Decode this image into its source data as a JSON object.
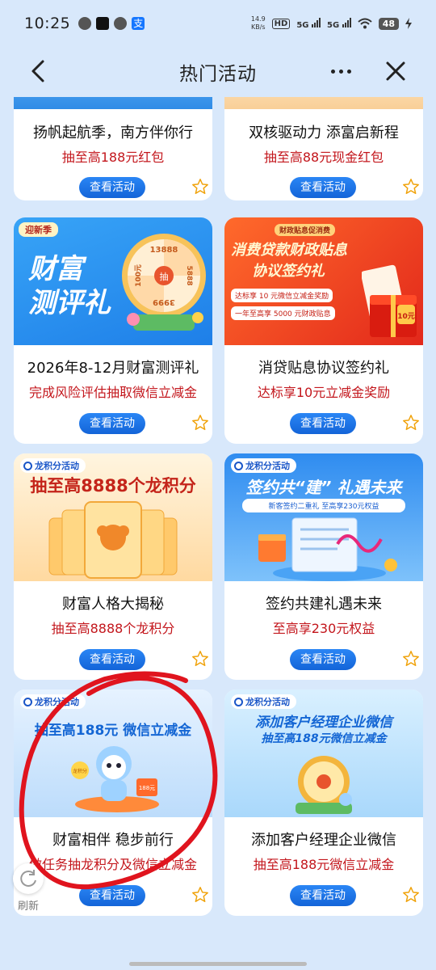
{
  "status_bar": {
    "time": "10:25",
    "net_speed": "14.9",
    "net_unit": "KB/s",
    "hd": "HD",
    "sig1": "5G",
    "sig2": "5G",
    "battery": "48"
  },
  "nav": {
    "title": "热门活动"
  },
  "cards": [
    {
      "title": "扬帆起航季，南方伴你行",
      "subtitle": "抽至高188元红包",
      "button": "查看活动"
    },
    {
      "title": "双核驱动力 添富启新程",
      "subtitle": "抽至高88元现金红包",
      "button": "查看活动"
    },
    {
      "title": "2026年8-12月财富测评礼",
      "subtitle": "完成风险评估抽取微信立减金",
      "button": "查看活动",
      "banner": {
        "tag": "迎新季",
        "headline1": "财富",
        "headline2": "测评礼",
        "wheel": [
          "13888",
          "5888",
          "3999",
          "100元",
          "抽"
        ]
      }
    },
    {
      "title": "消贷贴息协议签约礼",
      "subtitle": "达标享10元立减金奖励",
      "button": "查看活动",
      "banner": {
        "tag": "财政贴息促消费",
        "headline1": "消费贷款财政贴息",
        "headline2": "协议签约礼",
        "line1": "达标享 10 元微信立减金奖励",
        "line2": "一年至高享 5000 元财政贴息",
        "badge": "10元"
      }
    },
    {
      "title": "财富人格大揭秘",
      "subtitle": "抽至高8888个龙积分",
      "button": "查看活动",
      "banner": {
        "tag": "龙积分活动",
        "headline1": "抽至高8888个龙积分"
      }
    },
    {
      "title": "签约共建礼遇未来",
      "subtitle": "至高享230元权益",
      "button": "查看活动",
      "banner": {
        "tag": "龙积分活动",
        "headline1": "签约共“建” 礼遇未来",
        "line1": "新客签约二重礼 至高享230元权益"
      }
    },
    {
      "title": "财富相伴 稳步前行",
      "subtitle": "做任务抽龙积分及微信立减金",
      "button": "查看活动",
      "banner": {
        "tag": "龙积分活动",
        "headline1": "抽至高188元 微信立减金",
        "coin": "龙积分",
        "envelope": "188元"
      }
    },
    {
      "title": "添加客户经理企业微信",
      "subtitle": "抽至高188元微信立减金",
      "button": "查看活动",
      "banner": {
        "tag": "龙积分活动",
        "headline1": "添加客户经理企业微信",
        "headline2": "抽至高188元微信立减金"
      }
    }
  ],
  "refresh": {
    "label": "刷新"
  },
  "colors": {
    "accent": "#1a6fe0",
    "subtitle_red": "#c3161c",
    "annotation_red": "#e0141e"
  }
}
